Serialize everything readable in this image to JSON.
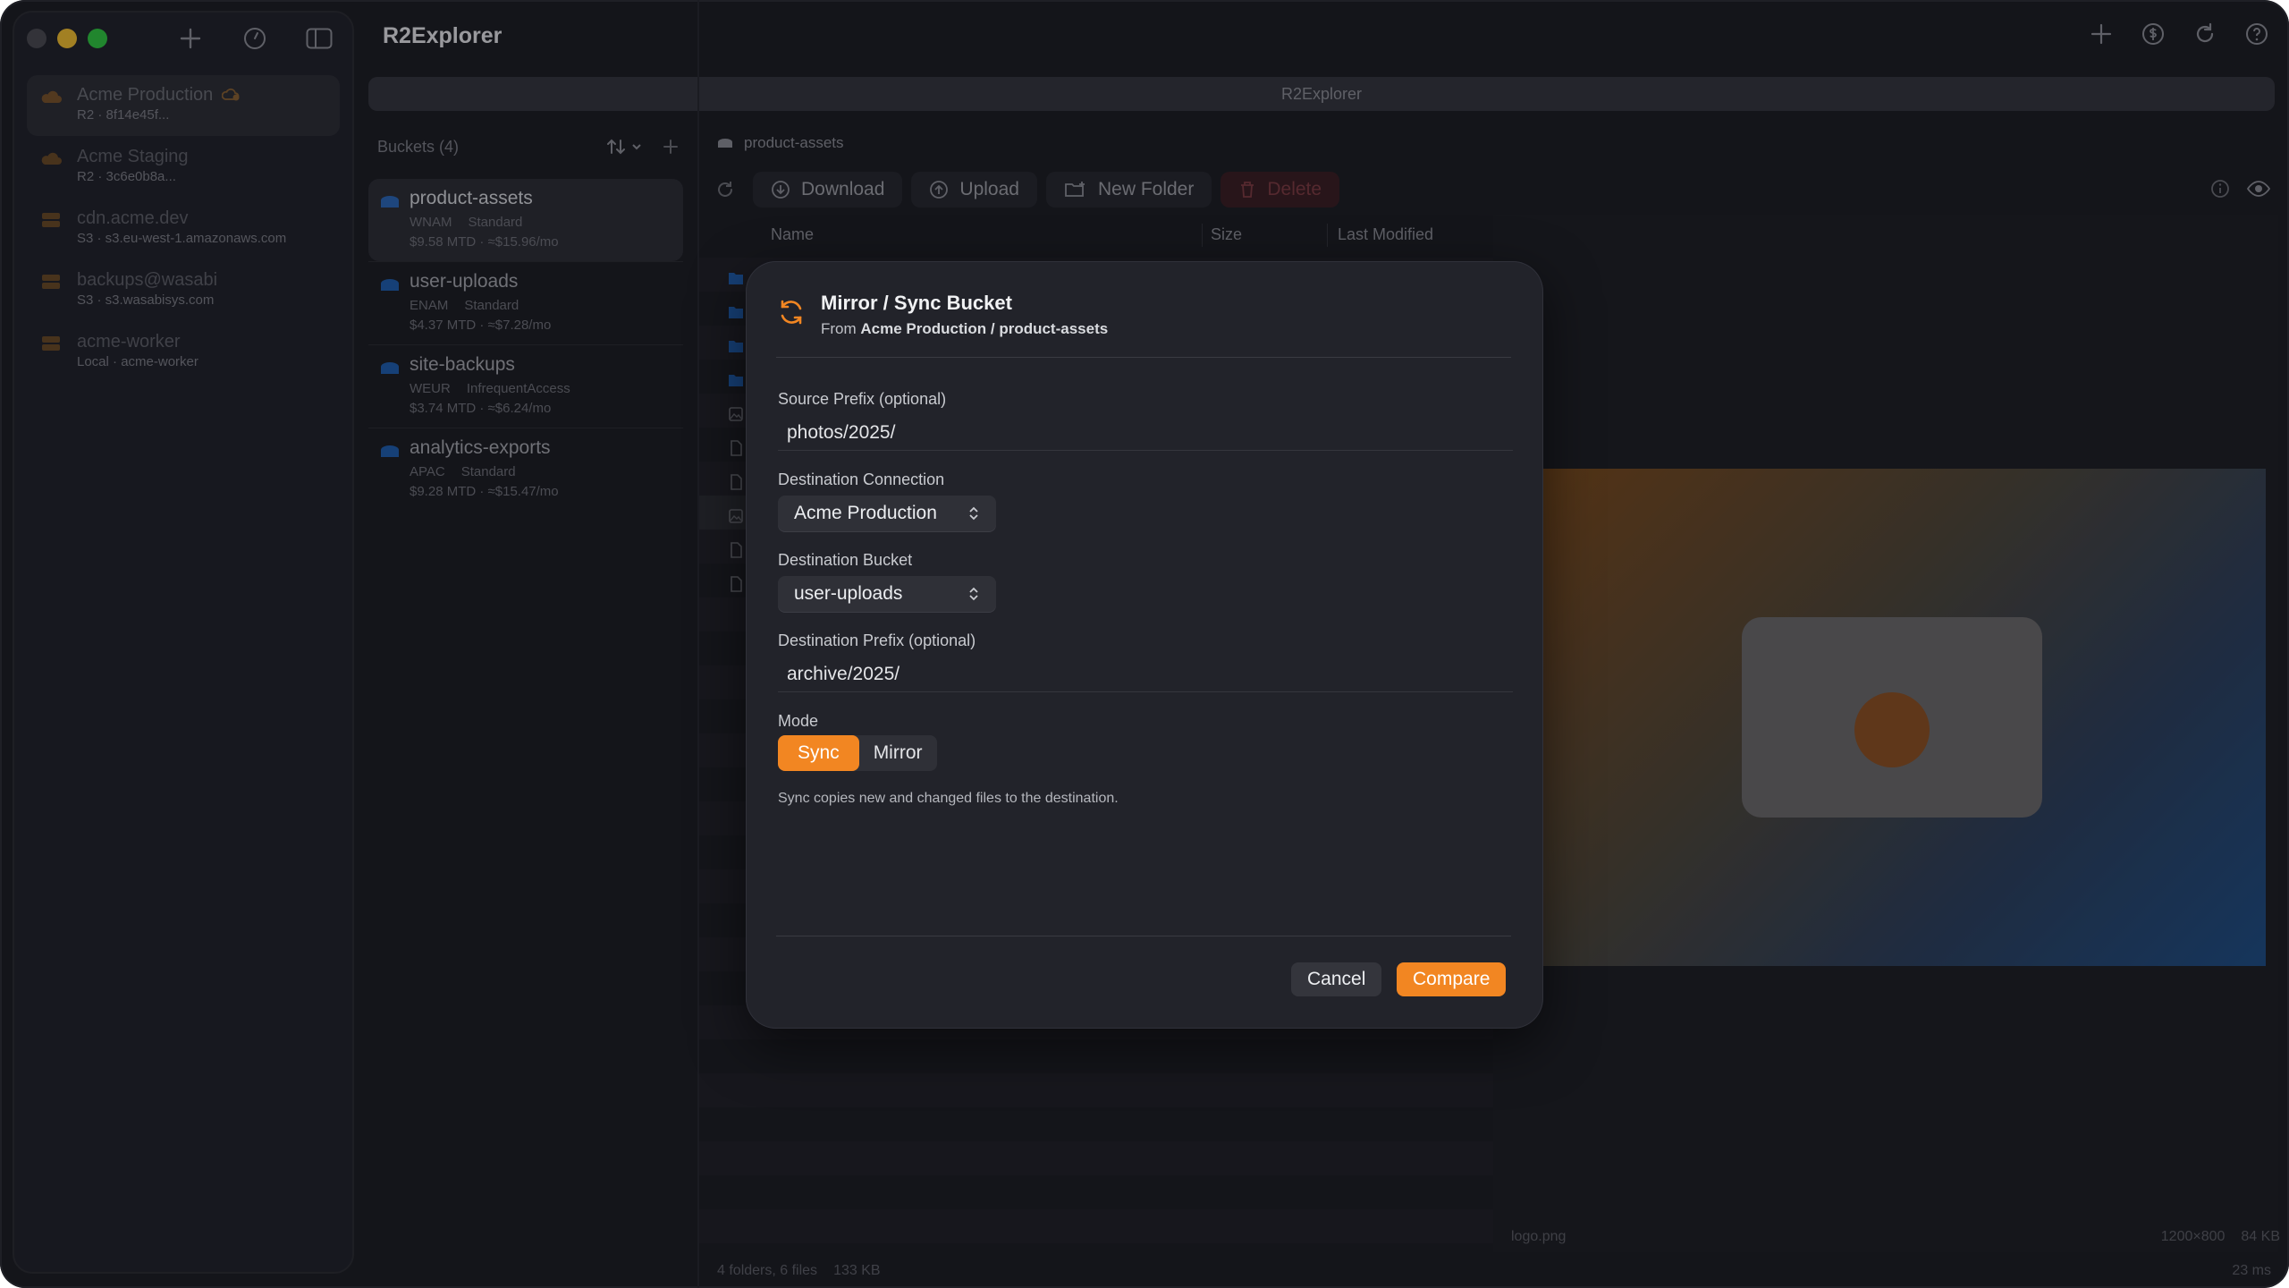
{
  "app": {
    "name": "R2Explorer",
    "address": "R2Explorer"
  },
  "colors": {
    "accent": "#f28622",
    "danger": "#d94a55",
    "folder": "#1e5fb0",
    "cloud": "#c27a26"
  },
  "sidebar": {
    "connections": [
      {
        "name": "Acme Production",
        "sub": "R2 · 8f14e45f...",
        "icon": "cloud-icon",
        "active": true
      },
      {
        "name": "Acme Staging",
        "sub": "R2 · 3c6e0b8a...",
        "icon": "cloud-icon"
      },
      {
        "name": "cdn.acme.dev",
        "sub": "S3 · s3.eu-west-1.amazonaws.com",
        "icon": "server-icon"
      },
      {
        "name": "backups@wasabi",
        "sub": "S3 · s3.wasabisys.com",
        "icon": "server-icon"
      },
      {
        "name": "acme-worker",
        "sub": "Local · acme-worker",
        "icon": "server-icon"
      }
    ]
  },
  "buckets": {
    "header": "Buckets (4)",
    "items": [
      {
        "name": "product-assets",
        "region": "WNAM",
        "class": "Standard",
        "cost": "$9.58 MTD · ≈$15.96/mo"
      },
      {
        "name": "user-uploads",
        "region": "ENAM",
        "class": "Standard",
        "cost": "$4.37 MTD · ≈$7.28/mo"
      },
      {
        "name": "site-backups",
        "region": "WEUR",
        "class": "InfrequentAccess",
        "cost": "$3.74 MTD · ≈$6.24/mo"
      },
      {
        "name": "analytics-exports",
        "region": "APAC",
        "class": "Standard",
        "cost": "$9.28 MTD · ≈$15.47/mo"
      }
    ]
  },
  "main": {
    "breadcrumb": "product-assets",
    "toolbar": {
      "download": "Download",
      "upload": "Upload",
      "new_folder": "New Folder",
      "delete": "Delete"
    },
    "columns": {
      "name": "Name",
      "size": "Size",
      "modified": "Last Modified"
    },
    "status": {
      "counts": "4 folders, 6 files",
      "size": "133 KB"
    }
  },
  "preview": {
    "filename": "logo.png",
    "dimensions": "1200×800",
    "size": "84 KB",
    "latency": "23 ms"
  },
  "modal": {
    "title": "Mirror / Sync Bucket",
    "subtitle_prefix": "From",
    "subtitle_source": "Acme Production / product-assets",
    "source_prefix_label": "Source Prefix (optional)",
    "source_prefix_value": "photos/2025/",
    "dest_connection_label": "Destination Connection",
    "dest_connection_value": "Acme Production",
    "dest_bucket_label": "Destination Bucket",
    "dest_bucket_value": "user-uploads",
    "dest_prefix_label": "Destination Prefix (optional)",
    "dest_prefix_value": "archive/2025/",
    "mode_label": "Mode",
    "mode_sync": "Sync",
    "mode_mirror": "Mirror",
    "mode_selected": "Sync",
    "help": "Sync copies new and changed files to the destination.",
    "cancel": "Cancel",
    "compare": "Compare"
  }
}
